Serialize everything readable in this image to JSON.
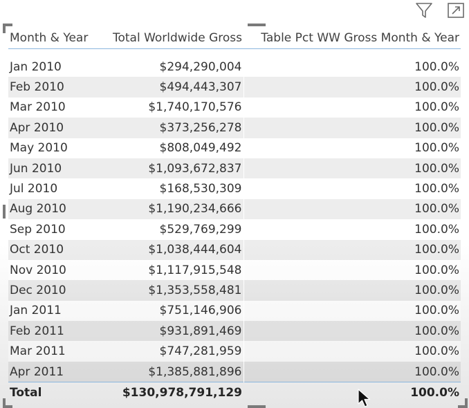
{
  "table": {
    "headers": [
      "Month & Year",
      "Total Worldwide Gross",
      "Table Pct WW Gross Month & Year"
    ],
    "rows": [
      {
        "month": "Jan 2010",
        "gross": "$294,290,004",
        "pct": "100.0%"
      },
      {
        "month": "Feb 2010",
        "gross": "$494,443,307",
        "pct": "100.0%"
      },
      {
        "month": "Mar 2010",
        "gross": "$1,740,170,576",
        "pct": "100.0%"
      },
      {
        "month": "Apr 2010",
        "gross": "$373,256,278",
        "pct": "100.0%"
      },
      {
        "month": "May 2010",
        "gross": "$808,049,492",
        "pct": "100.0%"
      },
      {
        "month": "Jun 2010",
        "gross": "$1,093,672,837",
        "pct": "100.0%"
      },
      {
        "month": "Jul 2010",
        "gross": "$168,530,309",
        "pct": "100.0%"
      },
      {
        "month": "Aug 2010",
        "gross": "$1,190,234,666",
        "pct": "100.0%"
      },
      {
        "month": "Sep 2010",
        "gross": "$529,769,299",
        "pct": "100.0%"
      },
      {
        "month": "Oct 2010",
        "gross": "$1,038,444,604",
        "pct": "100.0%"
      },
      {
        "month": "Nov 2010",
        "gross": "$1,117,915,548",
        "pct": "100.0%"
      },
      {
        "month": "Dec 2010",
        "gross": "$1,353,558,481",
        "pct": "100.0%"
      },
      {
        "month": "Jan 2011",
        "gross": "$751,146,906",
        "pct": "100.0%"
      },
      {
        "month": "Feb 2011",
        "gross": "$931,891,469",
        "pct": "100.0%"
      },
      {
        "month": "Mar 2011",
        "gross": "$747,281,959",
        "pct": "100.0%"
      },
      {
        "month": "Apr 2011",
        "gross": "$1,385,881,896",
        "pct": "100.0%"
      }
    ],
    "total": {
      "label": "Total",
      "gross": "$130,978,791,129",
      "pct": "100.0%"
    }
  },
  "icons": {
    "filter": "filter-icon",
    "focus_mode": "focus-mode-icon",
    "cursor": "mouse-pointer-icon"
  },
  "colors": {
    "header_rule": "#8ab6de",
    "text": "#333333",
    "frame": "#7a7a7a"
  }
}
